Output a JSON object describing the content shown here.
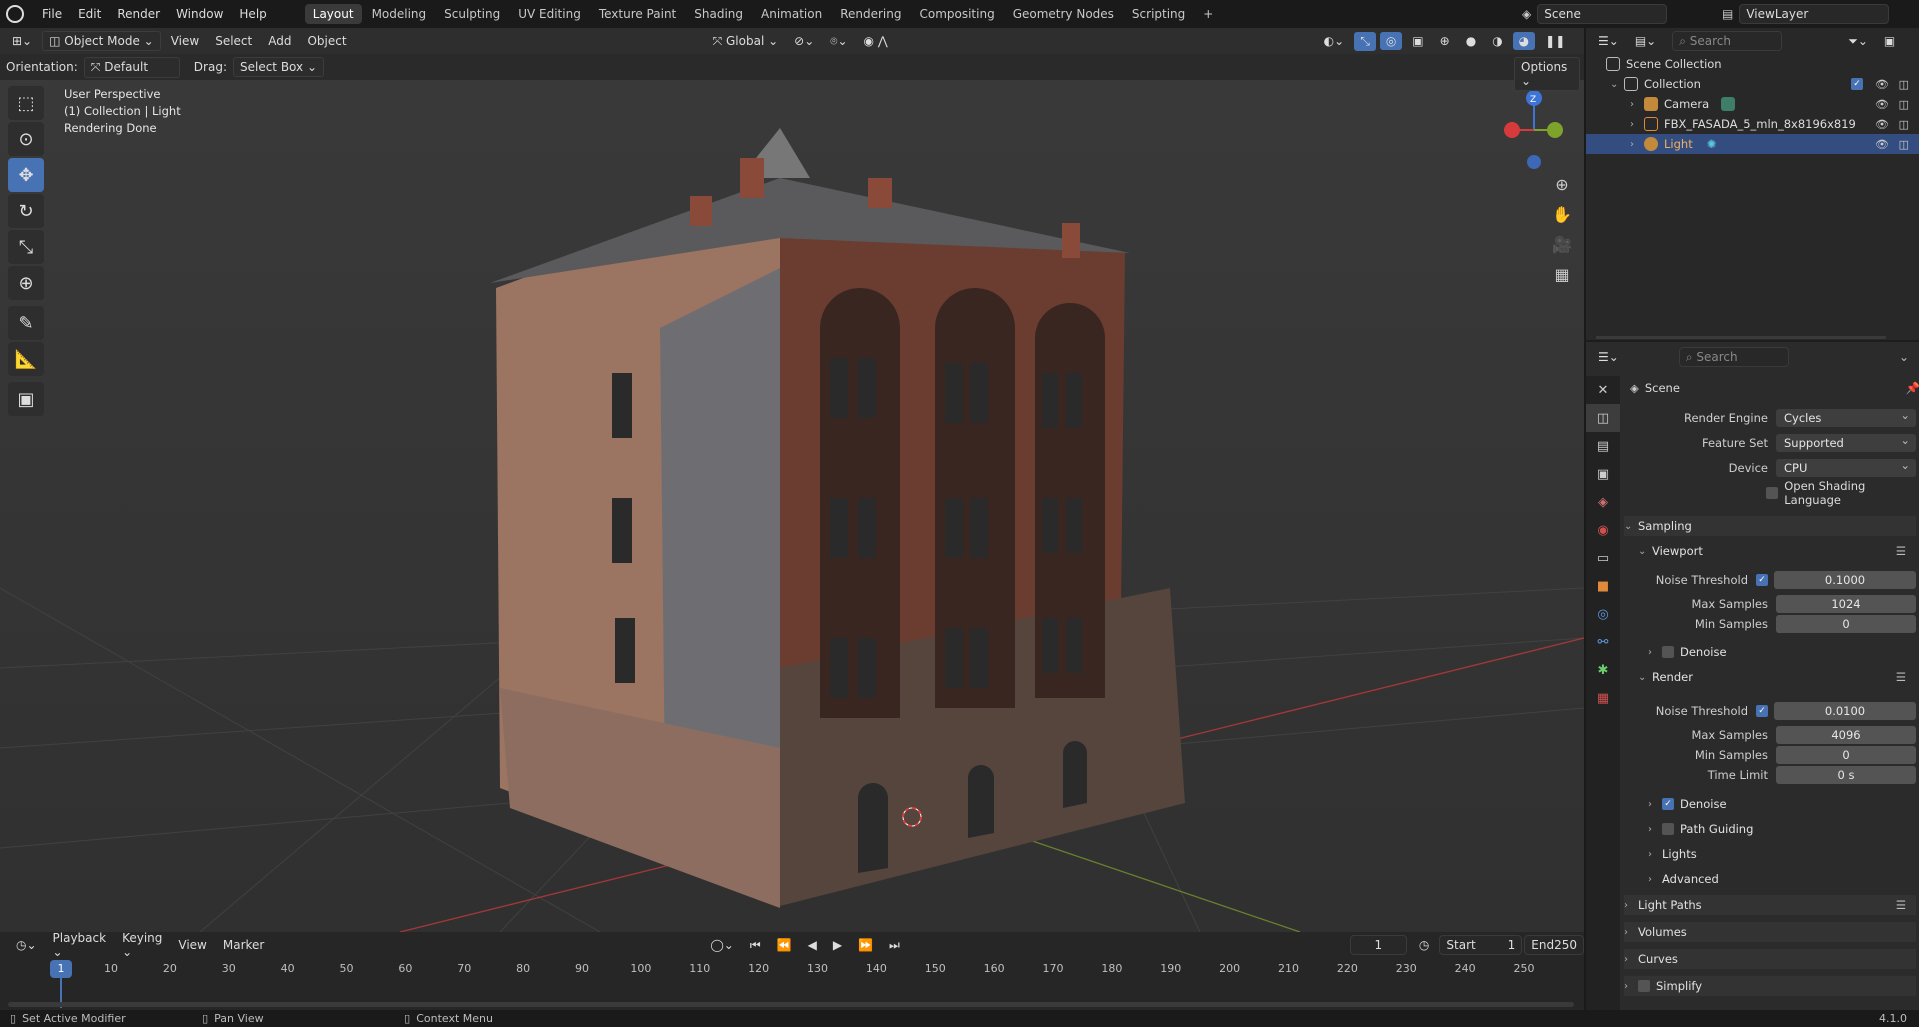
{
  "topbar": {
    "menus": [
      "File",
      "Edit",
      "Render",
      "Window",
      "Help"
    ],
    "workspaces": [
      "Layout",
      "Modeling",
      "Sculpting",
      "UV Editing",
      "Texture Paint",
      "Shading",
      "Animation",
      "Rendering",
      "Compositing",
      "Geometry Nodes",
      "Scripting"
    ],
    "active_workspace": "Layout",
    "add_tab": "+",
    "scene": "Scene",
    "view_layer": "ViewLayer"
  },
  "viewport": {
    "mode": "Object Mode",
    "menus": [
      "View",
      "Select",
      "Add",
      "Object"
    ],
    "transform_orientation": "Global",
    "orientation_label": "Orientation:",
    "orientation_value": "Default",
    "drag_label": "Drag:",
    "drag_value": "Select Box",
    "options": "Options",
    "info_line1": "User Perspective",
    "info_line2": "(1) Collection | Light",
    "info_line3": "Rendering Done",
    "search_placeholder": "Search",
    "gizmo_z": "Z"
  },
  "timeline": {
    "menus": [
      "Playback",
      "Keying",
      "View",
      "Marker"
    ],
    "current_frame": "1",
    "start_label": "Start",
    "start": "1",
    "end_label": "End",
    "end": "250",
    "ticks": [
      "1",
      "10",
      "20",
      "30",
      "40",
      "50",
      "60",
      "70",
      "80",
      "90",
      "100",
      "110",
      "120",
      "130",
      "140",
      "150",
      "160",
      "170",
      "180",
      "190",
      "200",
      "210",
      "220",
      "230",
      "240",
      "250"
    ]
  },
  "statusbar": {
    "left": "Set Active Modifier",
    "middle": "Pan View",
    "right": "Context Menu",
    "version": "4.1.0"
  },
  "outliner": {
    "search_placeholder": "Search",
    "root": "Scene Collection",
    "collection": "Collection",
    "items": [
      "Camera",
      "FBX_FASADA_5_mln_8x8196x819",
      "Light"
    ]
  },
  "properties": {
    "search_placeholder": "Search",
    "context": "Scene",
    "render_engine_label": "Render Engine",
    "render_engine": "Cycles",
    "feature_set_label": "Feature Set",
    "feature_set": "Supported",
    "device_label": "Device",
    "device": "CPU",
    "osl": "Open Shading Language",
    "sampling": "Sampling",
    "viewport_panel": "Viewport",
    "noise_threshold_label": "Noise Threshold",
    "viewport_noise": "0.1000",
    "max_samples_label": "Max Samples",
    "viewport_max": "1024",
    "min_samples_label": "Min Samples",
    "viewport_min": "0",
    "denoise": "Denoise",
    "render_panel": "Render",
    "render_noise": "0.0100",
    "render_max": "4096",
    "render_min": "0",
    "time_limit_label": "Time Limit",
    "time_limit": "0 s",
    "path_guiding": "Path Guiding",
    "lights": "Lights",
    "advanced": "Advanced",
    "light_paths": "Light Paths",
    "volumes": "Volumes",
    "curves": "Curves",
    "simplify": "Simplify"
  },
  "colors": {
    "accent": "#4772b3",
    "selected_row": "#334d80",
    "axis_x": "#d63a3a",
    "axis_y": "#7ea32a",
    "axis_z": "#3d74d6"
  }
}
